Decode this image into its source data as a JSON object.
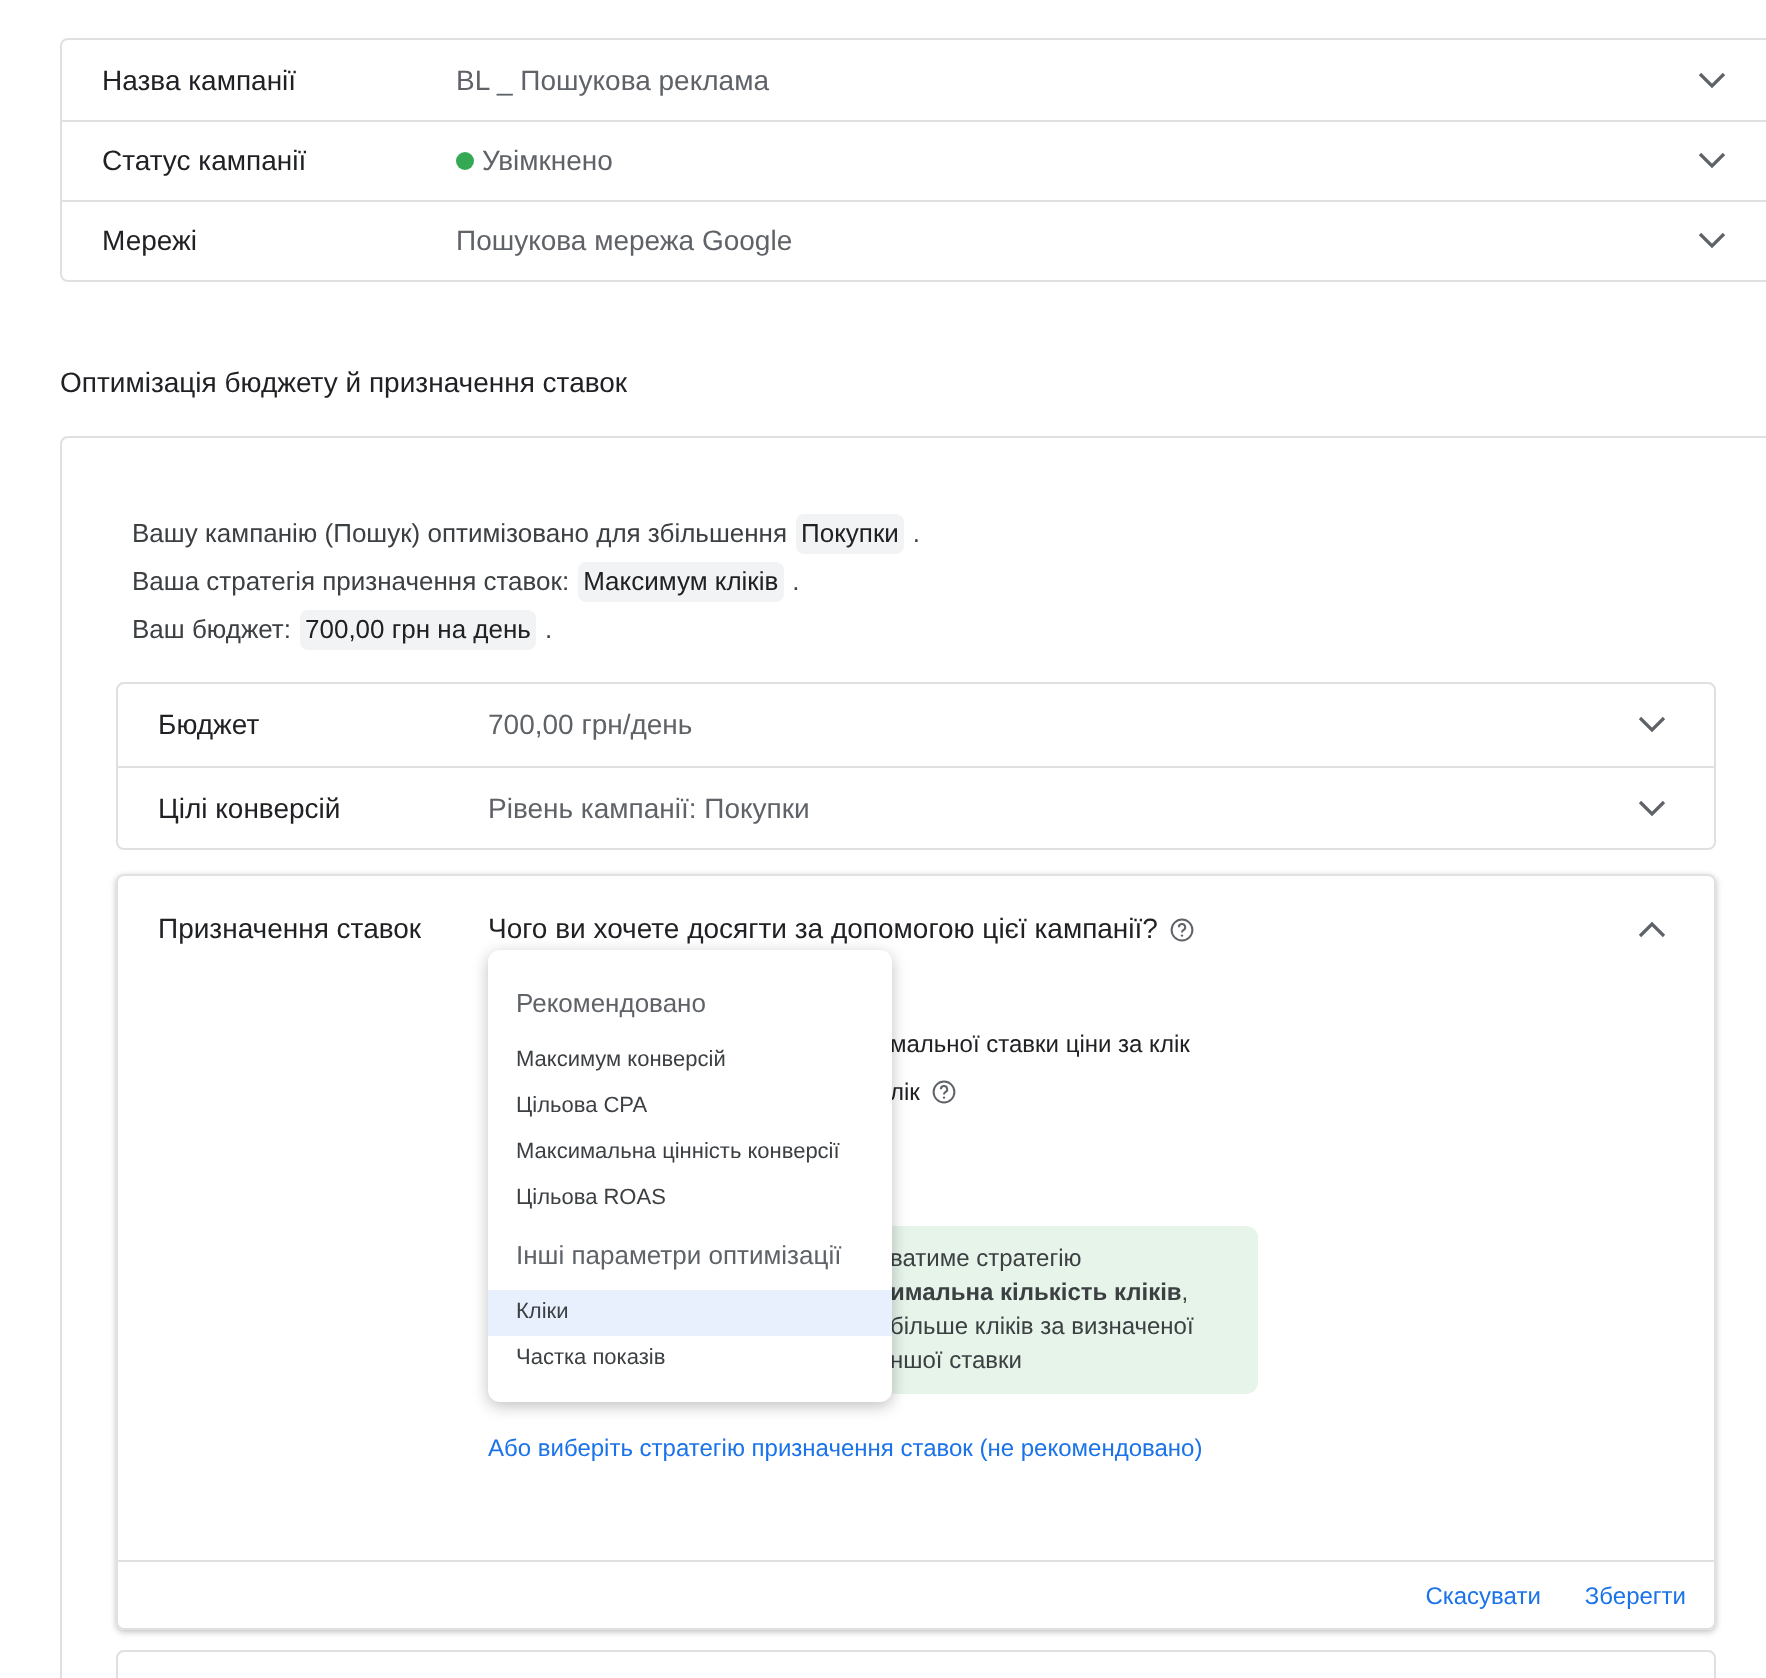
{
  "settings_rows": [
    {
      "label": "Назва кампанії",
      "value": "BL _ Пошукова реклама",
      "kind": "text"
    },
    {
      "label": "Статус кампанії",
      "value": "Увімкнено",
      "kind": "status",
      "color": "#34a853"
    },
    {
      "label": "Мережі",
      "value": "Пошукова мережа Google",
      "kind": "text"
    }
  ],
  "section_title": "Оптимізація бюджету й призначення ставок",
  "summary_chips": [
    {
      "before": "Вашу кампанію (Пошук) оптимізовано для збільшення",
      "chip": "Покупки",
      "after": "."
    },
    {
      "before": "Ваша стратегія призначення ставок:",
      "chip": "Максимум кліків",
      "after": "."
    },
    {
      "before": "Ваш бюджет:",
      "chip": "700,00 грн на день",
      "after": "."
    }
  ],
  "subrows": [
    {
      "label": "Бюджет",
      "value": "700,00 грн/день"
    },
    {
      "label": "Цілі конверсій",
      "value": "Рівень кампанії: Покупки"
    }
  ],
  "bidding": {
    "label": "Призначення ставок",
    "question": "Чого ви хочете досягти за допомогою цієї кампанії?",
    "expanded": true,
    "hidden_lines": [
      "мальної ставки ціни за клік",
      "лік"
    ],
    "info_box": [
      "ватиме стратегію",
      "**имальна кількість кліків**,",
      "більше кліків за визначеної",
      "ншої ставки"
    ],
    "link": "Або виберіть стратегію призначення ставок (не рекомендовано)",
    "buttons": [
      "Скасувати",
      "Зберегти"
    ]
  },
  "dropdown": [
    {
      "heading": "Рекомендовано",
      "items": [
        {
          "label": "Максимум конверсій",
          "selected": false
        },
        {
          "label": "Цільова CPA",
          "selected": false
        },
        {
          "label": "Максимальна цінність конверсії",
          "selected": false
        },
        {
          "label": "Цільова ROAS",
          "selected": false
        }
      ]
    },
    {
      "heading": "Інші параметри оптимізації",
      "items": [
        {
          "label": "Кліки",
          "selected": true
        },
        {
          "label": "Частка показів",
          "selected": false
        }
      ]
    }
  ]
}
